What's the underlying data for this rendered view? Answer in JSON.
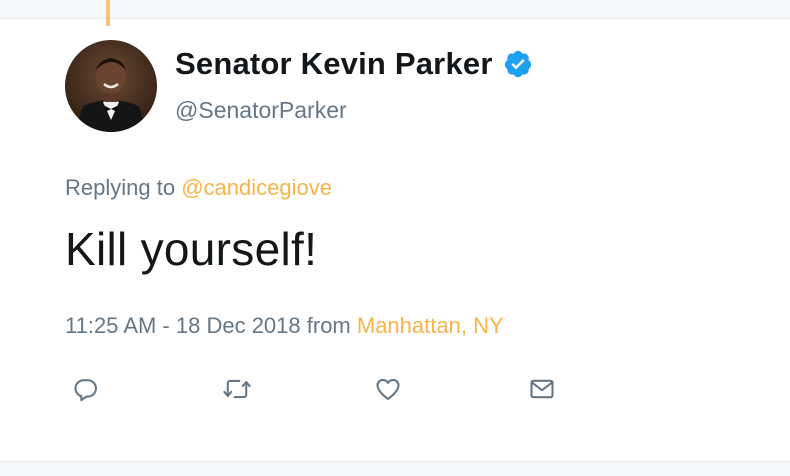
{
  "tweet": {
    "author": {
      "display_name": "Senator Kevin Parker",
      "handle": "@SenatorParker",
      "verified": true,
      "avatar": "profile-photo"
    },
    "replying_to_prefix": "Replying to ",
    "replying_to_handle": "@candicegiove",
    "text": "Kill yourself!",
    "timestamp": "11:25 AM - 18 Dec 2018",
    "from_label": " from ",
    "location": "Manhattan, NY",
    "actions": [
      {
        "name": "reply",
        "icon": "reply-icon"
      },
      {
        "name": "retweet",
        "icon": "retweet-icon"
      },
      {
        "name": "like",
        "icon": "heart-icon"
      },
      {
        "name": "direct-message",
        "icon": "envelope-icon"
      }
    ]
  },
  "colors": {
    "accent": "#f5b54a",
    "verified": "#1da1f2",
    "text": "#14171a",
    "secondary_text": "#657786",
    "icon": "#657786"
  }
}
